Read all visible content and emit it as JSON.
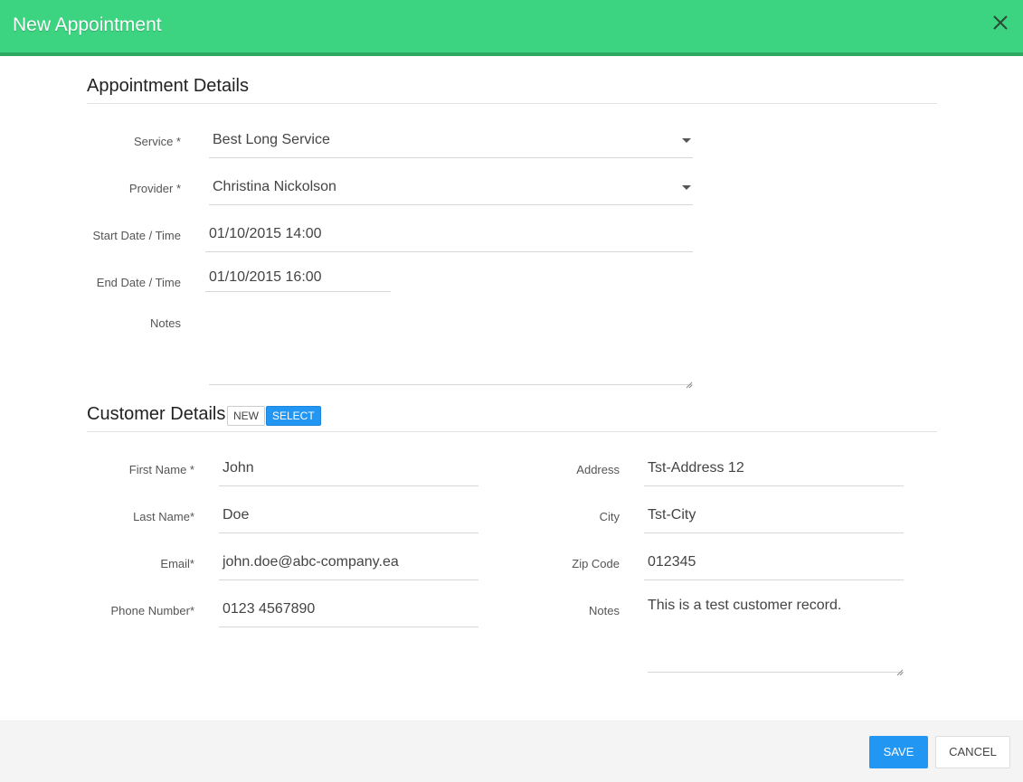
{
  "header": {
    "title": "New Appointment"
  },
  "appointment": {
    "section_title": "Appointment Details",
    "service": {
      "label": "Service *",
      "value": "Best Long Service"
    },
    "provider": {
      "label": "Provider *",
      "value": "Christina Nickolson"
    },
    "start": {
      "label": "Start Date / Time",
      "value": "01/10/2015 14:00"
    },
    "end": {
      "label": "End Date / Time",
      "value": "01/10/2015 16:00"
    },
    "notes": {
      "label": "Notes",
      "value": ""
    }
  },
  "customer": {
    "section_title": "Customer Details",
    "new_label": "NEW",
    "select_label": "SELECT",
    "first_name": {
      "label": "First Name *",
      "value": "John"
    },
    "last_name": {
      "label": "Last Name*",
      "value": "Doe"
    },
    "email": {
      "label": "Email*",
      "value": "john.doe@abc-company.ea"
    },
    "phone": {
      "label": "Phone Number*",
      "value": "0123 4567890"
    },
    "address": {
      "label": "Address",
      "value": "Tst-Address 12"
    },
    "city": {
      "label": "City",
      "value": "Tst-City"
    },
    "zip": {
      "label": "Zip Code",
      "value": "012345"
    },
    "notes": {
      "label": "Notes",
      "value": "This is a test customer record."
    }
  },
  "footer": {
    "save_label": "SAVE",
    "cancel_label": "CANCEL"
  },
  "colors": {
    "header": "#3dd481",
    "primary": "#2196f3"
  }
}
